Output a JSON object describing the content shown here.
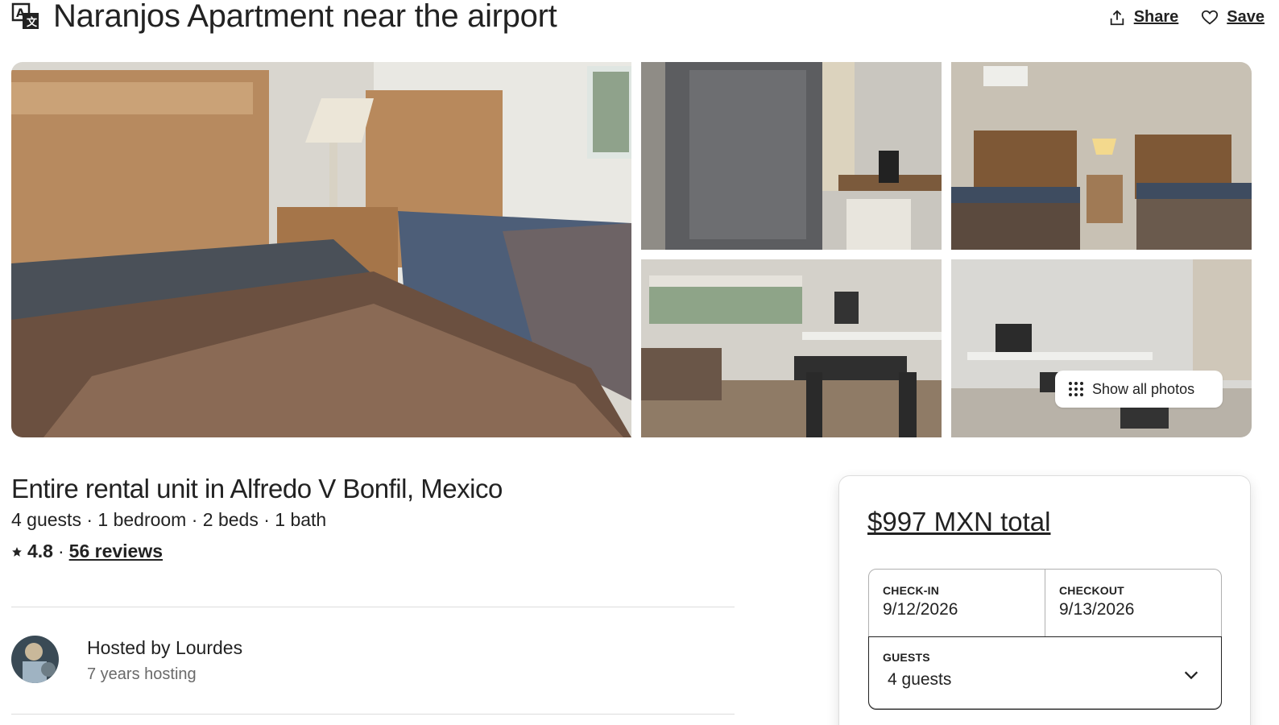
{
  "header": {
    "title": "Naranjos Apartment near the airport",
    "share_label": "Share",
    "save_label": "Save"
  },
  "gallery": {
    "show_all_label": "Show all photos"
  },
  "listing": {
    "subtitle": "Entire rental unit in Alfredo V Bonfil, Mexico",
    "facts": "4 guests · 1 bedroom · 2 beds · 1 bath",
    "rating": "4.8",
    "separator": "·",
    "reviews": "56 reviews"
  },
  "host": {
    "name": "Hosted by Lourdes",
    "years": "7 years hosting"
  },
  "booking": {
    "price": "$997 MXN total",
    "checkin_label": "CHECK-IN",
    "checkin_value": "9/12/2026",
    "checkout_label": "CHECKOUT",
    "checkout_value": "9/13/2026",
    "guests_label": "GUESTS",
    "guests_value": "4 guests"
  },
  "icons": {
    "translate": "translate-icon",
    "share": "share-icon",
    "save": "heart-icon",
    "show_all": "grid-dots-icon",
    "rating": "star-icon",
    "guests": "chevron-down-icon"
  },
  "colors": {
    "text": "#222222",
    "muted": "#6a6a6a",
    "border": "#dddddd"
  }
}
